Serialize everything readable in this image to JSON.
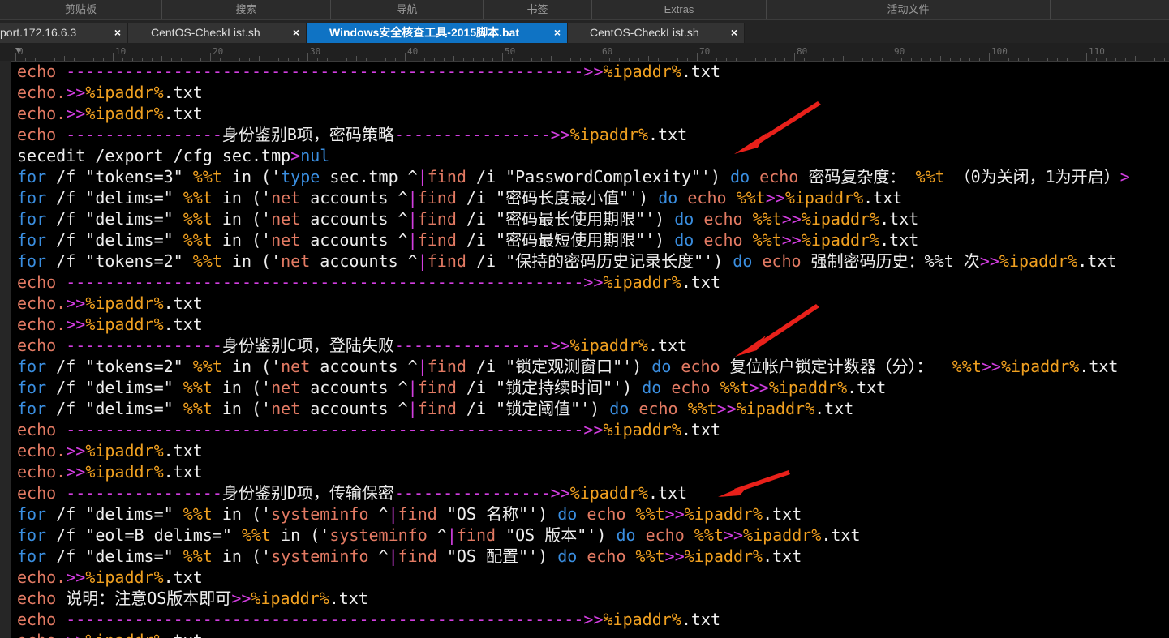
{
  "ribbon": {
    "groups": [
      "剪贴板",
      "搜索",
      "导航",
      "书签",
      "Extras",
      "活动文件"
    ]
  },
  "tabs": [
    {
      "label": "port.172.16.6.3",
      "close": "×"
    },
    {
      "label": "CentOS-CheckList.sh",
      "close": "×"
    },
    {
      "label": "Windows安全核查工具-2015脚本.bat",
      "close": "×",
      "active": true
    },
    {
      "label": "CentOS-CheckList.sh",
      "close": "×"
    }
  ],
  "ruler": {
    "numbers": [
      "0",
      "10",
      "20",
      "30",
      "40",
      "50",
      "60",
      "70",
      "80",
      "90",
      "100",
      "110"
    ]
  },
  "colors": {
    "keyword_echo": "#e27a63",
    "keyword_for": "#3a8ee0",
    "operator": "#d23ee0",
    "variable": "#f0a020",
    "tab_active": "#0f73c4",
    "arrow": "#e8201a"
  },
  "annotations": {
    "arrow_color": "#e8201a",
    "arrow_count": 3
  },
  "code_lines": [
    [
      [
        "echo ",
        "c-echo"
      ],
      [
        "-----------------------------------------------------",
        "c-dash"
      ],
      [
        ">>",
        "c-op"
      ],
      [
        "%ipaddr%",
        "c-var"
      ],
      [
        ".txt",
        "c-def"
      ]
    ],
    [
      [
        "echo.",
        "c-echo"
      ],
      [
        ">>",
        "c-op"
      ],
      [
        "%ipaddr%",
        "c-var"
      ],
      [
        ".txt",
        "c-def"
      ]
    ],
    [
      [
        "echo.",
        "c-echo"
      ],
      [
        ">>",
        "c-op"
      ],
      [
        "%ipaddr%",
        "c-var"
      ],
      [
        ".txt",
        "c-def"
      ]
    ],
    [
      [
        "echo ",
        "c-echo"
      ],
      [
        "----------------",
        "c-dash"
      ],
      [
        "身份鉴别B项，密码策略",
        "c-def"
      ],
      [
        "----------------",
        "c-dash"
      ],
      [
        ">>",
        "c-op"
      ],
      [
        "%ipaddr%",
        "c-var"
      ],
      [
        ".txt",
        "c-def"
      ]
    ],
    [
      [
        "secedit /export /cfg sec.tmp",
        "c-def"
      ],
      [
        ">",
        "c-op"
      ],
      [
        "nul",
        "c-for"
      ]
    ],
    [
      [
        "for",
        "c-for"
      ],
      [
        " /f \"tokens=3\" ",
        "c-def"
      ],
      [
        "%%t",
        "c-var"
      ],
      [
        " in ('",
        "c-def"
      ],
      [
        "type",
        "c-for"
      ],
      [
        " sec.tmp ^",
        "c-def"
      ],
      [
        "|",
        "c-op"
      ],
      [
        "find",
        "c-kw"
      ],
      [
        " /i \"PasswordComplexity\"') ",
        "c-def"
      ],
      [
        "do",
        "c-do"
      ],
      [
        " echo ",
        "c-echo"
      ],
      [
        "密码复杂度： ",
        "c-def"
      ],
      [
        "%%t",
        "c-var"
      ],
      [
        " （0为关闭，1为开启）",
        "c-def"
      ],
      [
        ">",
        "c-op"
      ]
    ],
    [
      [
        "for",
        "c-for"
      ],
      [
        " /f \"delims=\" ",
        "c-def"
      ],
      [
        "%%t",
        "c-var"
      ],
      [
        " in ('",
        "c-def"
      ],
      [
        "net",
        "c-kw"
      ],
      [
        " accounts ^",
        "c-def"
      ],
      [
        "|",
        "c-op"
      ],
      [
        "find",
        "c-kw"
      ],
      [
        " /i \"密码长度最小值\"') ",
        "c-def"
      ],
      [
        "do",
        "c-do"
      ],
      [
        " echo ",
        "c-echo"
      ],
      [
        "%%t",
        "c-var"
      ],
      [
        ">>",
        "c-op"
      ],
      [
        "%ipaddr%",
        "c-var"
      ],
      [
        ".txt",
        "c-def"
      ]
    ],
    [
      [
        "for",
        "c-for"
      ],
      [
        " /f \"delims=\" ",
        "c-def"
      ],
      [
        "%%t",
        "c-var"
      ],
      [
        " in ('",
        "c-def"
      ],
      [
        "net",
        "c-kw"
      ],
      [
        " accounts ^",
        "c-def"
      ],
      [
        "|",
        "c-op"
      ],
      [
        "find",
        "c-kw"
      ],
      [
        " /i \"密码最长使用期限\"') ",
        "c-def"
      ],
      [
        "do",
        "c-do"
      ],
      [
        " echo ",
        "c-echo"
      ],
      [
        "%%t",
        "c-var"
      ],
      [
        ">>",
        "c-op"
      ],
      [
        "%ipaddr%",
        "c-var"
      ],
      [
        ".txt",
        "c-def"
      ]
    ],
    [
      [
        "for",
        "c-for"
      ],
      [
        " /f \"delims=\" ",
        "c-def"
      ],
      [
        "%%t",
        "c-var"
      ],
      [
        " in ('",
        "c-def"
      ],
      [
        "net",
        "c-kw"
      ],
      [
        " accounts ^",
        "c-def"
      ],
      [
        "|",
        "c-op"
      ],
      [
        "find",
        "c-kw"
      ],
      [
        " /i \"密码最短使用期限\"') ",
        "c-def"
      ],
      [
        "do",
        "c-do"
      ],
      [
        " echo ",
        "c-echo"
      ],
      [
        "%%t",
        "c-var"
      ],
      [
        ">>",
        "c-op"
      ],
      [
        "%ipaddr%",
        "c-var"
      ],
      [
        ".txt",
        "c-def"
      ]
    ],
    [
      [
        "for",
        "c-for"
      ],
      [
        " /f \"tokens=2\" ",
        "c-def"
      ],
      [
        "%%t",
        "c-var"
      ],
      [
        " in ('",
        "c-def"
      ],
      [
        "net",
        "c-kw"
      ],
      [
        " accounts ^",
        "c-def"
      ],
      [
        "|",
        "c-op"
      ],
      [
        "find",
        "c-kw"
      ],
      [
        " /i \"保持的密码历史记录长度\"') ",
        "c-def"
      ],
      [
        "do",
        "c-do"
      ],
      [
        " echo ",
        "c-echo"
      ],
      [
        "强制密码历史：%%t 次",
        "c-def"
      ],
      [
        ">>",
        "c-op"
      ],
      [
        "%ipaddr%",
        "c-var"
      ],
      [
        ".txt",
        "c-def"
      ]
    ],
    [
      [
        "echo ",
        "c-echo"
      ],
      [
        "-----------------------------------------------------",
        "c-dash"
      ],
      [
        ">>",
        "c-op"
      ],
      [
        "%ipaddr%",
        "c-var"
      ],
      [
        ".txt",
        "c-def"
      ]
    ],
    [
      [
        "echo.",
        "c-echo"
      ],
      [
        ">>",
        "c-op"
      ],
      [
        "%ipaddr%",
        "c-var"
      ],
      [
        ".txt",
        "c-def"
      ]
    ],
    [
      [
        "echo.",
        "c-echo"
      ],
      [
        ">>",
        "c-op"
      ],
      [
        "%ipaddr%",
        "c-var"
      ],
      [
        ".txt",
        "c-def"
      ]
    ],
    [
      [
        "echo ",
        "c-echo"
      ],
      [
        "----------------",
        "c-dash"
      ],
      [
        "身份鉴别C项，登陆失败",
        "c-def"
      ],
      [
        "----------------",
        "c-dash"
      ],
      [
        ">>",
        "c-op"
      ],
      [
        "%ipaddr%",
        "c-var"
      ],
      [
        ".txt",
        "c-def"
      ]
    ],
    [
      [
        "for",
        "c-for"
      ],
      [
        " /f \"tokens=2\" ",
        "c-def"
      ],
      [
        "%%t",
        "c-var"
      ],
      [
        " in ('",
        "c-def"
      ],
      [
        "net",
        "c-kw"
      ],
      [
        " accounts ^",
        "c-def"
      ],
      [
        "|",
        "c-op"
      ],
      [
        "find",
        "c-kw"
      ],
      [
        " /i \"锁定观测窗口\"') ",
        "c-def"
      ],
      [
        "do",
        "c-do"
      ],
      [
        " echo ",
        "c-echo"
      ],
      [
        "复位帐户锁定计数器（分）：  ",
        "c-def"
      ],
      [
        "%%t",
        "c-var"
      ],
      [
        ">>",
        "c-op"
      ],
      [
        "%ipaddr%",
        "c-var"
      ],
      [
        ".txt",
        "c-def"
      ]
    ],
    [
      [
        "for",
        "c-for"
      ],
      [
        " /f \"delims=\" ",
        "c-def"
      ],
      [
        "%%t",
        "c-var"
      ],
      [
        " in ('",
        "c-def"
      ],
      [
        "net",
        "c-kw"
      ],
      [
        " accounts ^",
        "c-def"
      ],
      [
        "|",
        "c-op"
      ],
      [
        "find",
        "c-kw"
      ],
      [
        " /i \"锁定持续时间\"') ",
        "c-def"
      ],
      [
        "do",
        "c-do"
      ],
      [
        " echo ",
        "c-echo"
      ],
      [
        "%%t",
        "c-var"
      ],
      [
        ">>",
        "c-op"
      ],
      [
        "%ipaddr%",
        "c-var"
      ],
      [
        ".txt",
        "c-def"
      ]
    ],
    [
      [
        "for",
        "c-for"
      ],
      [
        " /f \"delims=\" ",
        "c-def"
      ],
      [
        "%%t",
        "c-var"
      ],
      [
        " in ('",
        "c-def"
      ],
      [
        "net",
        "c-kw"
      ],
      [
        " accounts ^",
        "c-def"
      ],
      [
        "|",
        "c-op"
      ],
      [
        "find",
        "c-kw"
      ],
      [
        " /i \"锁定阈值\"') ",
        "c-def"
      ],
      [
        "do",
        "c-do"
      ],
      [
        " echo ",
        "c-echo"
      ],
      [
        "%%t",
        "c-var"
      ],
      [
        ">>",
        "c-op"
      ],
      [
        "%ipaddr%",
        "c-var"
      ],
      [
        ".txt",
        "c-def"
      ]
    ],
    [
      [
        "echo ",
        "c-echo"
      ],
      [
        "-----------------------------------------------------",
        "c-dash"
      ],
      [
        ">>",
        "c-op"
      ],
      [
        "%ipaddr%",
        "c-var"
      ],
      [
        ".txt",
        "c-def"
      ]
    ],
    [
      [
        "echo.",
        "c-echo"
      ],
      [
        ">>",
        "c-op"
      ],
      [
        "%ipaddr%",
        "c-var"
      ],
      [
        ".txt",
        "c-def"
      ]
    ],
    [
      [
        "echo.",
        "c-echo"
      ],
      [
        ">>",
        "c-op"
      ],
      [
        "%ipaddr%",
        "c-var"
      ],
      [
        ".txt",
        "c-def"
      ]
    ],
    [
      [
        "echo ",
        "c-echo"
      ],
      [
        "----------------",
        "c-dash"
      ],
      [
        "身份鉴别D项，传输保密",
        "c-def"
      ],
      [
        "----------------",
        "c-dash"
      ],
      [
        ">>",
        "c-op"
      ],
      [
        "%ipaddr%",
        "c-var"
      ],
      [
        ".txt",
        "c-def"
      ]
    ],
    [
      [
        "for",
        "c-for"
      ],
      [
        " /f \"delims=\" ",
        "c-def"
      ],
      [
        "%%t",
        "c-var"
      ],
      [
        " in ('",
        "c-def"
      ],
      [
        "systeminfo",
        "c-kw"
      ],
      [
        " ^",
        "c-def"
      ],
      [
        "|",
        "c-op"
      ],
      [
        "find",
        "c-kw"
      ],
      [
        " \"OS 名称\"') ",
        "c-def"
      ],
      [
        "do",
        "c-do"
      ],
      [
        " echo ",
        "c-echo"
      ],
      [
        "%%t",
        "c-var"
      ],
      [
        ">>",
        "c-op"
      ],
      [
        "%ipaddr%",
        "c-var"
      ],
      [
        ".txt",
        "c-def"
      ]
    ],
    [
      [
        "for",
        "c-for"
      ],
      [
        " /f \"eol=B delims=\" ",
        "c-def"
      ],
      [
        "%%t",
        "c-var"
      ],
      [
        " in ('",
        "c-def"
      ],
      [
        "systeminfo",
        "c-kw"
      ],
      [
        " ^",
        "c-def"
      ],
      [
        "|",
        "c-op"
      ],
      [
        "find",
        "c-kw"
      ],
      [
        " \"OS 版本\"') ",
        "c-def"
      ],
      [
        "do",
        "c-do"
      ],
      [
        " echo ",
        "c-echo"
      ],
      [
        "%%t",
        "c-var"
      ],
      [
        ">>",
        "c-op"
      ],
      [
        "%ipaddr%",
        "c-var"
      ],
      [
        ".txt",
        "c-def"
      ]
    ],
    [
      [
        "for",
        "c-for"
      ],
      [
        " /f \"delims=\" ",
        "c-def"
      ],
      [
        "%%t",
        "c-var"
      ],
      [
        " in ('",
        "c-def"
      ],
      [
        "systeminfo",
        "c-kw"
      ],
      [
        " ^",
        "c-def"
      ],
      [
        "|",
        "c-op"
      ],
      [
        "find",
        "c-kw"
      ],
      [
        " \"OS 配置\"') ",
        "c-def"
      ],
      [
        "do",
        "c-do"
      ],
      [
        " echo ",
        "c-echo"
      ],
      [
        "%%t",
        "c-var"
      ],
      [
        ">>",
        "c-op"
      ],
      [
        "%ipaddr%",
        "c-var"
      ],
      [
        ".txt",
        "c-def"
      ]
    ],
    [
      [
        "echo.",
        "c-echo"
      ],
      [
        ">>",
        "c-op"
      ],
      [
        "%ipaddr%",
        "c-var"
      ],
      [
        ".txt",
        "c-def"
      ]
    ],
    [
      [
        "echo ",
        "c-echo"
      ],
      [
        "说明：注意OS版本即可",
        "c-def"
      ],
      [
        ">>",
        "c-op"
      ],
      [
        "%ipaddr%",
        "c-var"
      ],
      [
        ".txt",
        "c-def"
      ]
    ],
    [
      [
        "echo ",
        "c-echo"
      ],
      [
        "-----------------------------------------------------",
        "c-dash"
      ],
      [
        ">>",
        "c-op"
      ],
      [
        "%ipaddr%",
        "c-var"
      ],
      [
        ".txt",
        "c-def"
      ]
    ],
    [
      [
        "echo.",
        "c-echo"
      ],
      [
        ">>",
        "c-op"
      ],
      [
        "%ipaddr%",
        "c-var"
      ],
      [
        ".txt",
        "c-def"
      ]
    ]
  ]
}
